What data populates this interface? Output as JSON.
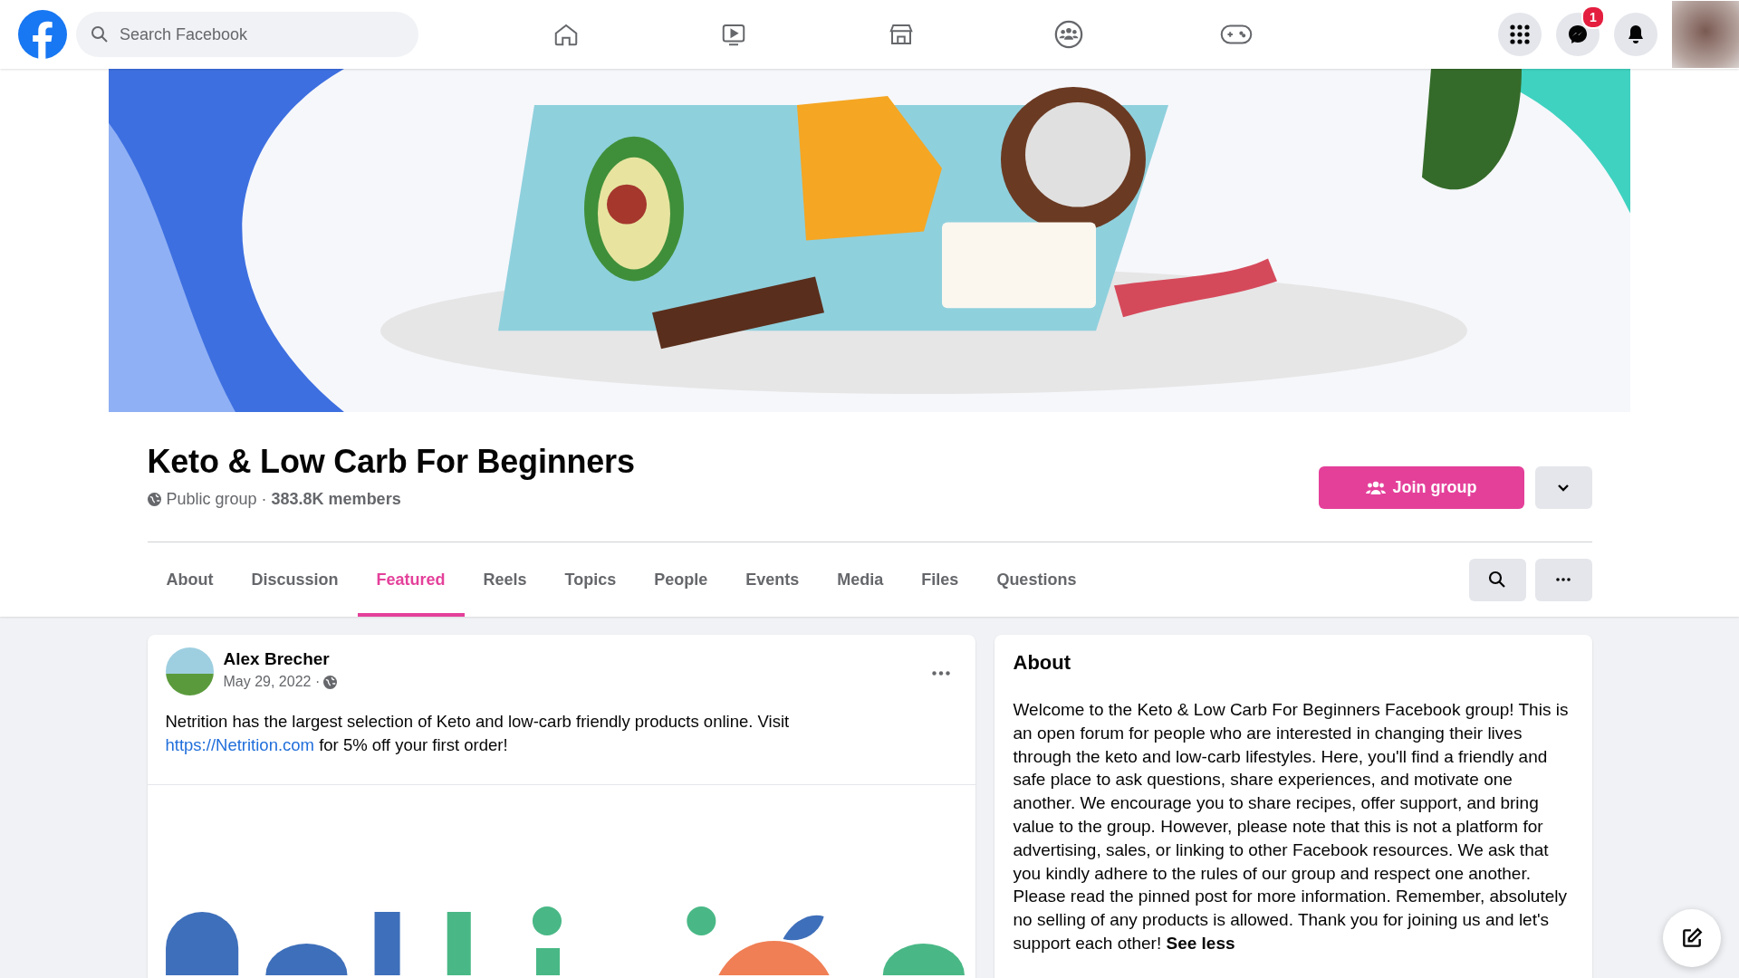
{
  "topbar": {
    "search": {
      "placeholder": "Search Facebook"
    },
    "nav": [
      {
        "kind": "home"
      },
      {
        "kind": "video"
      },
      {
        "kind": "marketplace"
      },
      {
        "kind": "groups"
      },
      {
        "kind": "gaming"
      }
    ],
    "actions": [
      {
        "kind": "menu"
      },
      {
        "kind": "messenger",
        "badge": "1"
      },
      {
        "kind": "notifications"
      }
    ]
  },
  "group": {
    "name": "Keto & Low Carb For Beginners",
    "privacy": "Public group",
    "separator": "·",
    "members": "383.8K members",
    "join_button": "Join group"
  },
  "tabs": [
    {
      "label": "About",
      "selected": false
    },
    {
      "label": "Discussion",
      "selected": false
    },
    {
      "label": "Featured",
      "selected": true
    },
    {
      "label": "Reels",
      "selected": false
    },
    {
      "label": "Topics",
      "selected": false
    },
    {
      "label": "People",
      "selected": false
    },
    {
      "label": "Events",
      "selected": false
    },
    {
      "label": "Media",
      "selected": false
    },
    {
      "label": "Files",
      "selected": false
    },
    {
      "label": "Questions",
      "selected": false
    }
  ],
  "post": {
    "author": "Alex Brecher",
    "date": "May 29, 2022 ·",
    "text_before": "Netrition has the largest selection of Keto and low-carb friendly products online. Visit ",
    "link": "https://Netrition.com",
    "text_after": " for 5% off your first order!"
  },
  "about": {
    "title": "About",
    "text": "Welcome to the Keto & Low Carb For Beginners Facebook group! This is an open forum for people who are interested in changing their lives through the keto and low-carb lifestyles. Here, you'll find a friendly and safe place to ask questions, share experiences, and motivate one another. We encourage you to share recipes, offer support, and bring value to the group. However, please note that this is not a platform for advertising, sales, or linking to other Facebook resources. We ask that you kindly adhere to the rules of our group and respect one another. Please read the pinned post for more information. Remember, absolutely no selling of any products is allowed. Thank you for joining us and let's support each other!",
    "see_less": "See less"
  }
}
